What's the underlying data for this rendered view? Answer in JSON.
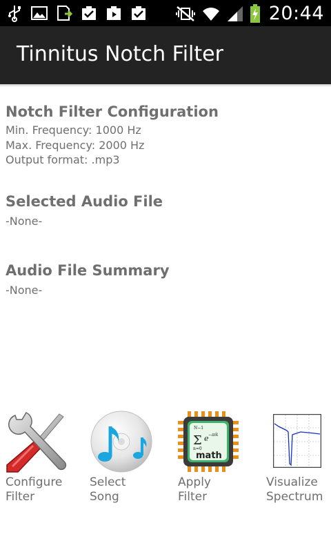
{
  "status_bar": {
    "time": "20:44",
    "icons_left": [
      "usb-icon",
      "image-icon",
      "download-icon",
      "clipboard-check-icon",
      "clipboard-play-icon",
      "clipboard-check-icon"
    ],
    "icons_right": [
      "mute-vibrate-icon",
      "wifi-icon",
      "signal-icon",
      "battery-charging-icon"
    ]
  },
  "header": {
    "title": "Tinnitus Notch Filter"
  },
  "config": {
    "title": "Notch Filter Configuration",
    "min_frequency": "Min. Frequency: 1000 Hz",
    "max_frequency": "Max. Frequency: 2000 Hz",
    "output_format": "Output format: .mp3"
  },
  "selected_file": {
    "title": "Selected Audio File",
    "value": "-None-"
  },
  "summary": {
    "title": "Audio File Summary",
    "value": "-None-"
  },
  "actions": [
    {
      "line1": "Configure",
      "line2": "Filter",
      "icon": "wrench-screwdriver-icon"
    },
    {
      "line1": "Select",
      "line2": "Song",
      "icon": "music-cd-icon"
    },
    {
      "line1": "Apply",
      "line2": "Filter",
      "icon": "math-chip-icon"
    },
    {
      "line1": "Visualize",
      "line2": "Spectrum",
      "icon": "spectrum-plot-icon"
    }
  ],
  "colors": {
    "action_bar": "#232323",
    "status_bar": "#000000",
    "text_gray": "#6f6f6f",
    "battery_green": "#8cc63f"
  }
}
